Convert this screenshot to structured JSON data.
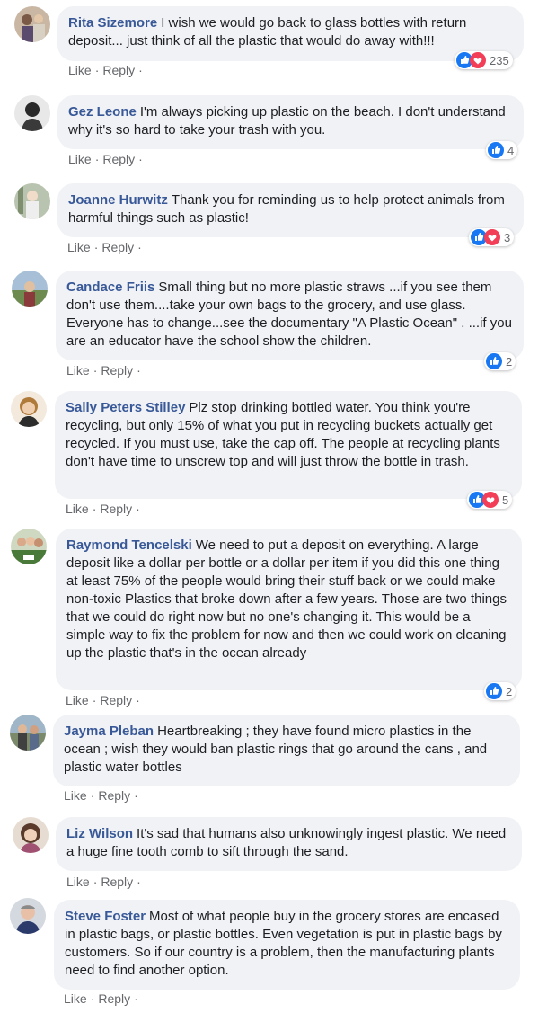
{
  "actions": {
    "like": "Like",
    "reply": "Reply",
    "separator": "·"
  },
  "colors": {
    "author": "#385898",
    "bubble": "#f0f2f5",
    "like_blue": "#1877f2",
    "love_red": "#f33e58"
  },
  "comments": [
    {
      "author": "Rita Sizemore",
      "text": "I wish we would go back to glass bottles with return deposit... just think of all the plastic that would do away with!!!",
      "reactions": [
        "like-icon",
        "love-icon"
      ],
      "reaction_count": "235"
    },
    {
      "author": "Gez Leone",
      "text": "I'm always picking up plastic on the beach. I don't understand why it's so hard to take your trash with you.",
      "reactions": [
        "like-icon"
      ],
      "reaction_count": "4"
    },
    {
      "author": "Joanne Hurwitz",
      "text": "Thank you for reminding us to help protect animals from harmful things such as plastic!",
      "reactions": [
        "like-icon",
        "love-icon"
      ],
      "reaction_count": "3"
    },
    {
      "author": "Candace Friis",
      "text": "Small thing but no more plastic straws ...if you see them don't use them....take your own bags to the grocery, and use glass. Everyone has to change...see the documentary \"A Plastic Ocean\" . ...if you are an educator have the school show the children.",
      "reactions": [
        "like-icon"
      ],
      "reaction_count": "2"
    },
    {
      "author": "Sally Peters Stilley",
      "text": "Plz stop drinking bottled water. You think you're recycling, but only 15% of what you put in recycling buckets actually get recycled. If you must use, take the cap off. The people at recycling plants don't have time to unscrew top and will just throw the bottle in trash.",
      "reactions": [
        "like-icon",
        "love-icon"
      ],
      "reaction_count": "5"
    },
    {
      "author": "Raymond Tencelski",
      "text": "We need to put a deposit on everything. A large deposit like a dollar per bottle or a dollar per item if you did this one thing at least 75% of the people would bring their stuff back or we could make non-toxic Plastics that broke down after a few years. Those are two things that we could do right now but no one's changing it. This would be a simple way to fix the problem for now and then we could work on cleaning up the plastic that's in the ocean already",
      "reactions": [
        "like-icon"
      ],
      "reaction_count": "2"
    },
    {
      "author": "Jayma Pleban",
      "text": "Heartbreaking ; they have found micro plastics in the ocean ; wish they would ban plastic rings that go around the cans , and plastic water bottles",
      "reactions": [],
      "reaction_count": ""
    },
    {
      "author": "Liz Wilson",
      "text": "It's sad that humans also unknowingly ingest plastic. We need a huge fine tooth comb to sift through the sand.",
      "reactions": [],
      "reaction_count": ""
    },
    {
      "author": "Steve Foster",
      "text": "Most of what people buy in the grocery stores are encased in plastic bags, or plastic bottles. Even vegetation is put in plastic bags by customers. So if our country is a problem, then the manufacturing plants need to find another option.",
      "reactions": [],
      "reaction_count": ""
    }
  ]
}
